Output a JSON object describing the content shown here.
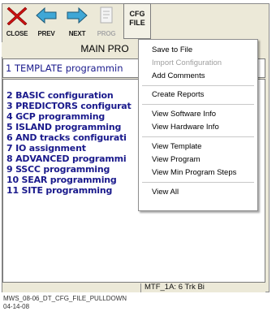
{
  "toolbar": {
    "close_label": "CLOSE",
    "prev_label": "PREV",
    "next_label": "NEXT",
    "prog_label": "PROG",
    "cfg_line1": "CFG",
    "cfg_line2": "FILE"
  },
  "title": "MAIN PRO",
  "list": {
    "first": "1 TEMPLATE programmin",
    "items": [
      "2 BASIC configuration",
      "3 PREDICTORS configurat",
      "4 GCP programming",
      "5 ISLAND programming",
      "6 AND tracks configurati",
      "7 IO assignment",
      "8 ADVANCED programmi",
      "9 SSCC programming",
      "10 SEAR programming",
      "11 SITE programming"
    ]
  },
  "status": "MTF_1A: 6 Trk Bi",
  "caption": {
    "line1": "MWS_08-06_DT_CFG_FILE_PULLDOWN",
    "line2": "04-14-08"
  },
  "menu": {
    "items": [
      {
        "label": "Save to File",
        "enabled": true
      },
      {
        "label": "Import Configuration",
        "enabled": false
      },
      {
        "label": "Add Comments",
        "enabled": true
      },
      {
        "label": "Create Reports",
        "enabled": true
      },
      {
        "label": "View Software Info",
        "enabled": true
      },
      {
        "label": "View Hardware Info",
        "enabled": true
      },
      {
        "label": "View Template",
        "enabled": true
      },
      {
        "label": "View Program",
        "enabled": true
      },
      {
        "label": "View Min Program Steps",
        "enabled": true
      },
      {
        "label": "View All",
        "enabled": true
      }
    ]
  },
  "colors": {
    "list_text": "#1a1a8c",
    "close_icon": "#cc1111",
    "arrow_fill": "#3fa7d6"
  }
}
